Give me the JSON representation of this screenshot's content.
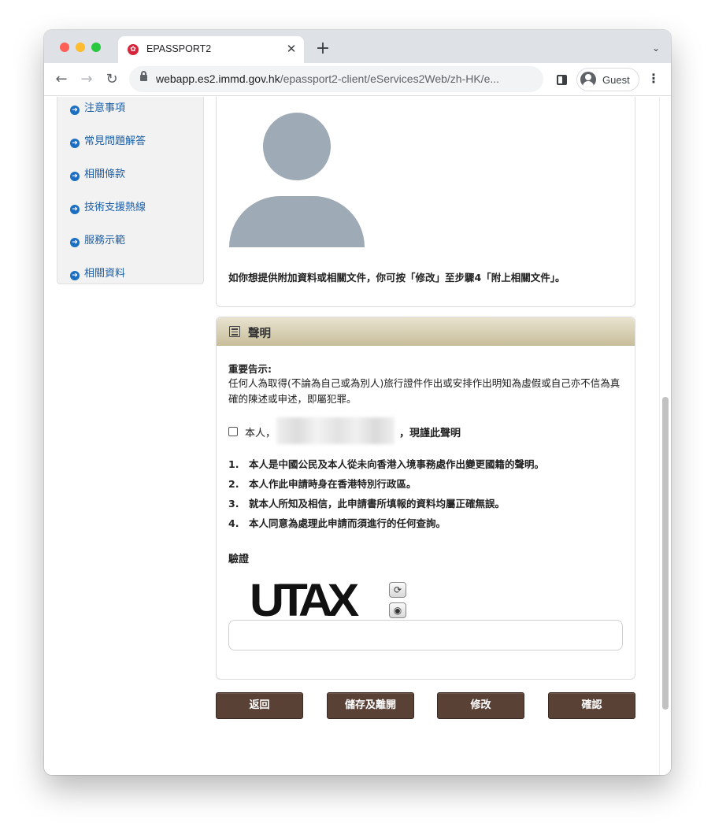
{
  "browser": {
    "tab_title": "EPASSPORT2",
    "url_host": "webapp.es2.immd.gov.hk",
    "url_path": "/epassport2-client/eServices2Web/zh-HK/e...",
    "profile_label": "Guest"
  },
  "sidebar": {
    "items": [
      {
        "label": "注意事項"
      },
      {
        "label": "常見問題解答"
      },
      {
        "label": "相關條款"
      },
      {
        "label": "技術支援熱線"
      },
      {
        "label": "服務示範"
      },
      {
        "label": "相關資料"
      }
    ]
  },
  "photo_card": {
    "note": "如你想提供附加資料或相關文件，你可按「修改」至步驟4「附上相關文件」。"
  },
  "declaration": {
    "title": "聲明",
    "warning_title": "重要告示:",
    "warning_text": "任何人為取得(不論為自己或為別人)旅行證件作出或安排作出明知為虛假或自己亦不信為真確的陳述或申述，即屬犯罪。",
    "checkbox_prefix": "本人，",
    "checkbox_suffix": "，現謹此聲明",
    "items": [
      {
        "num": "1.",
        "text": "本人是中國公民及本人從未向香港入境事務處作出變更國籍的聲明。"
      },
      {
        "num": "2.",
        "text": "本人作此申請時身在香港特別行政區。"
      },
      {
        "num": "3.",
        "text": "就本人所知及相信，此申請書所填報的資料均屬正確無誤。"
      },
      {
        "num": "4.",
        "text": "本人同意為處理此申請而須進行的任何查詢。"
      }
    ],
    "verify_label": "驗證",
    "captcha_text": "UTAX",
    "captcha_input_value": ""
  },
  "buttons": {
    "back": "返回",
    "save_exit": "儲存及離開",
    "modify": "修改",
    "confirm": "確認"
  },
  "colors": {
    "button_bg": "#5a4136",
    "link": "#1b5fa8",
    "header_gradient_top": "#e8e3d0",
    "header_gradient_bottom": "#c9bf9c",
    "silhouette": "#9eaab5"
  }
}
